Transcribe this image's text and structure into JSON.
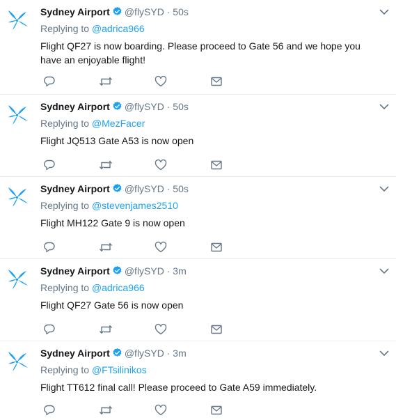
{
  "colors": {
    "accent": "#1da1f2",
    "muted": "#657786",
    "text": "#14171a",
    "divider": "#e6ecf0"
  },
  "icons": {
    "avatar": "sydney-airport-bird-logo",
    "verified": "verified-badge",
    "menu": "chevron-down",
    "reply": "reply-bubble",
    "retweet": "retweet-arrows",
    "like": "heart",
    "message": "envelope"
  },
  "tweets": [
    {
      "name": "Sydney Airport",
      "handle": "@flySYD",
      "dot": "·",
      "time": "50s",
      "reply_label": "Replying to",
      "reply_user": "@adrica966",
      "text": "Flight QF27 is now boarding. Please proceed to Gate 56 and we hope you have an enjoyable flight!"
    },
    {
      "name": "Sydney Airport",
      "handle": "@flySYD",
      "dot": "·",
      "time": "50s",
      "reply_label": "Replying to",
      "reply_user": "@MezFacer",
      "text": "Flight JQ513 Gate A53 is now open"
    },
    {
      "name": "Sydney Airport",
      "handle": "@flySYD",
      "dot": "·",
      "time": "50s",
      "reply_label": "Replying to",
      "reply_user": "@stevenjames2510",
      "text": "Flight MH122 Gate 9 is now open"
    },
    {
      "name": "Sydney Airport",
      "handle": "@flySYD",
      "dot": "·",
      "time": "3m",
      "reply_label": "Replying to",
      "reply_user": "@adrica966",
      "text": "Flight QF27 Gate 56 is now open"
    },
    {
      "name": "Sydney Airport",
      "handle": "@flySYD",
      "dot": "·",
      "time": "3m",
      "reply_label": "Replying to",
      "reply_user": "@FTsilinikos",
      "text": "Flight TT612 final call! Please proceed to Gate A59 immediately."
    }
  ]
}
